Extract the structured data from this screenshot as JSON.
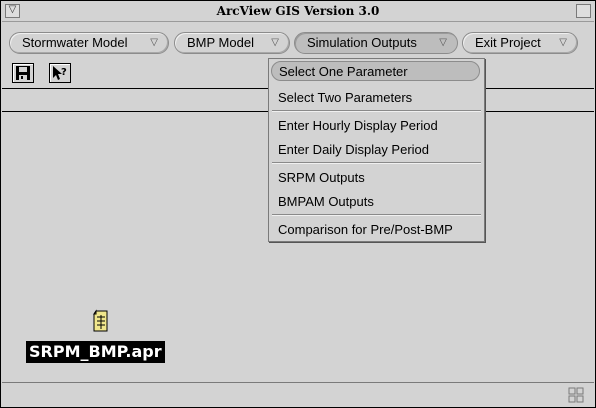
{
  "window": {
    "title": "ArcView GIS Version 3.0"
  },
  "menubar": {
    "items": [
      {
        "label": "Stormwater Model"
      },
      {
        "label": "BMP Model"
      },
      {
        "label": "Simulation Outputs"
      },
      {
        "label": "Exit Project"
      }
    ]
  },
  "toolbar": {
    "buttons": [
      {
        "icon": "save-icon"
      },
      {
        "icon": "help-icon"
      }
    ]
  },
  "dropdown": {
    "items": [
      {
        "label": "Select One Parameter",
        "highlighted": true
      },
      {
        "label": "Select Two Parameters"
      },
      {
        "label": "Enter Hourly Display Period"
      },
      {
        "label": "Enter Daily Display Period"
      },
      {
        "label": "SRPM Outputs"
      },
      {
        "label": "BMPAM Outputs"
      },
      {
        "label": "Comparison for Pre/Post-BMP"
      }
    ]
  },
  "workspace": {
    "project": {
      "filename": "SRPM_BMP.apr",
      "icon": "project-file-icon"
    }
  },
  "colors": {
    "chrome": "#d3d3d3",
    "highlight": "#bdbdbd",
    "label_bg": "#000000",
    "label_fg": "#ffffff"
  }
}
